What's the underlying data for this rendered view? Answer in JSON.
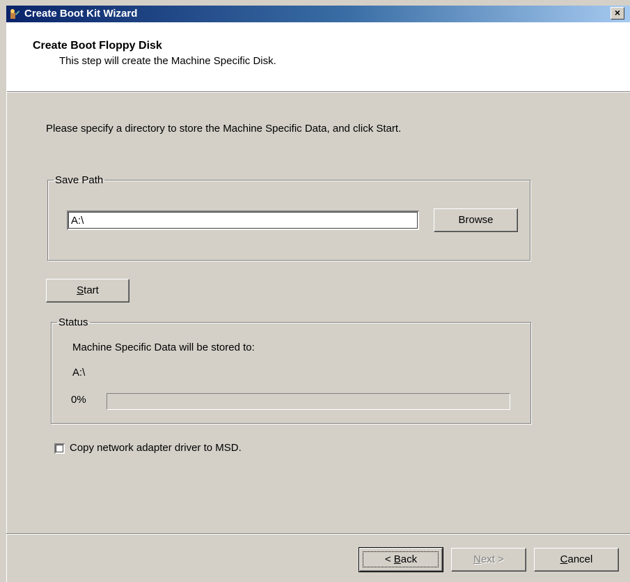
{
  "window": {
    "title": "Create Boot Kit Wizard",
    "close_glyph": "×",
    "app_icon": "wizard-app-icon"
  },
  "header": {
    "step_title": "Create Boot Floppy Disk",
    "step_description": "This step will create the Machine Specific Disk."
  },
  "instructions": "Please specify a directory to store the Machine Specific Data, and click Start.",
  "save_path": {
    "legend": "Save Path",
    "value": "A:\\",
    "browse_label": "Browse"
  },
  "start_button": {
    "accel": "S",
    "rest": "tart"
  },
  "status": {
    "legend": "Status",
    "message": "Machine Specific Data will be stored to:",
    "path": "A:\\",
    "percent_label": "0%",
    "progress": 0
  },
  "checkbox": {
    "label": "Copy network adapter driver to MSD.",
    "checked": false
  },
  "footer": {
    "back": {
      "prefix": "< ",
      "accel": "B",
      "rest": "ack"
    },
    "next": {
      "accel": "N",
      "rest": "ext >"
    },
    "cancel": {
      "accel": "C",
      "rest": "ancel"
    }
  },
  "colors": {
    "title_gradient_start": "#0a246a",
    "title_gradient_end": "#a6caf0",
    "dialog_background": "#d4d0c8"
  }
}
